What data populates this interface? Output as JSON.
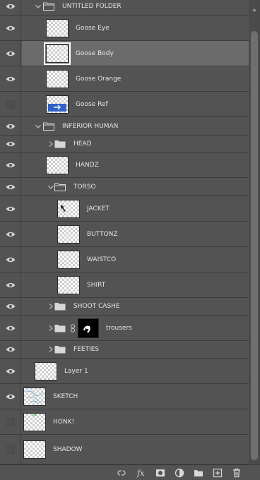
{
  "panel": "layers",
  "layers": [
    {
      "kind": "group",
      "name": "UNTITLED FOLDER",
      "visible": true,
      "expanded": true,
      "depth": 0
    },
    {
      "kind": "layer",
      "name": "Goose Eye",
      "visible": true,
      "depth": 1
    },
    {
      "kind": "layer",
      "name": "Goose Body",
      "visible": true,
      "depth": 1,
      "selected": true
    },
    {
      "kind": "layer",
      "name": "Goose Orange",
      "visible": true,
      "depth": 1
    },
    {
      "kind": "layer",
      "name": "Goose Ref",
      "visible": false,
      "depth": 1
    },
    {
      "kind": "group",
      "name": "INFERIOR HUMAN",
      "visible": true,
      "expanded": true,
      "depth": 0
    },
    {
      "kind": "group",
      "name": "HEAD",
      "visible": true,
      "expanded": false,
      "depth": 1
    },
    {
      "kind": "layer",
      "name": "HANDZ",
      "visible": true,
      "depth": 1
    },
    {
      "kind": "group",
      "name": "TORSO",
      "visible": true,
      "expanded": true,
      "depth": 1
    },
    {
      "kind": "layer",
      "name": "JACKET",
      "visible": true,
      "depth": 2
    },
    {
      "kind": "layer",
      "name": "BUTTONZ",
      "visible": true,
      "depth": 2
    },
    {
      "kind": "layer",
      "name": "WAISTCO",
      "visible": true,
      "depth": 2
    },
    {
      "kind": "layer",
      "name": "SHIRT",
      "visible": true,
      "depth": 2
    },
    {
      "kind": "group",
      "name": "SHOOT CASHE",
      "visible": true,
      "expanded": false,
      "depth": 1
    },
    {
      "kind": "group",
      "name": "trousers",
      "visible": true,
      "expanded": false,
      "depth": 1,
      "mask": true
    },
    {
      "kind": "group",
      "name": "FEETIES",
      "visible": true,
      "expanded": false,
      "depth": 1
    },
    {
      "kind": "layer",
      "name": "Layer 1",
      "visible": true,
      "depth": 0
    },
    {
      "kind": "layer",
      "name": "SKETCH",
      "visible": true,
      "depth": -1
    },
    {
      "kind": "layer",
      "name": "HONK!",
      "visible": false,
      "depth": -1
    },
    {
      "kind": "layer",
      "name": "SHADOW",
      "visible": false,
      "depth": -1
    }
  ],
  "toolbar": [
    "link-layers",
    "add-style",
    "add-mask",
    "adjustment",
    "new-group",
    "new-layer",
    "delete"
  ],
  "colors": {
    "panel": "#535353",
    "selected": "#6b6b6b",
    "text": "#e4e4e4",
    "divider": "#3c3c3c"
  }
}
